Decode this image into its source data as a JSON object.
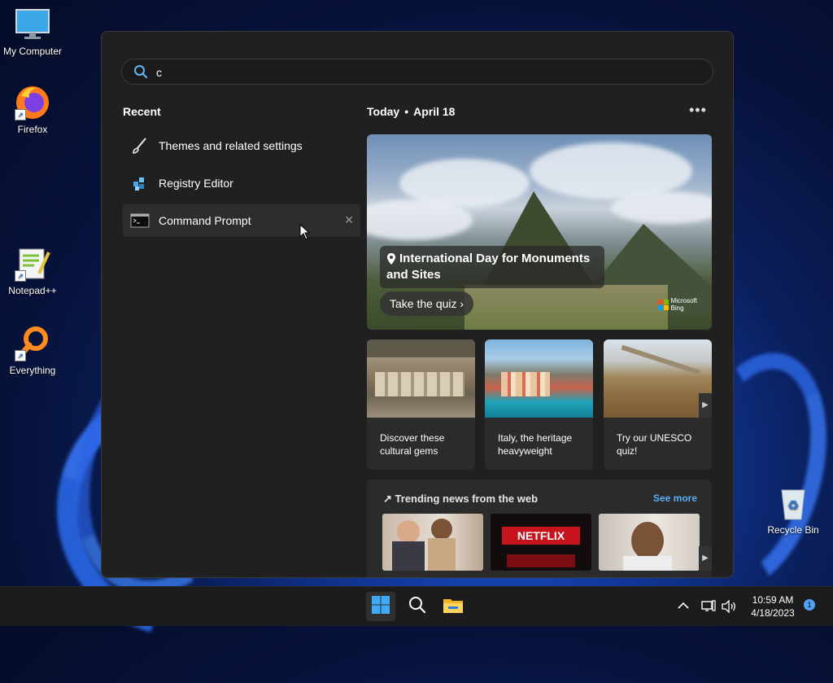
{
  "desktop": {
    "icons": [
      {
        "label": "My Computer"
      },
      {
        "label": "Firefox"
      },
      {
        "label": "Notepad++"
      },
      {
        "label": "Everything"
      },
      {
        "label": "Recycle Bin"
      }
    ]
  },
  "search": {
    "value": "c",
    "placeholder": ""
  },
  "recent": {
    "title": "Recent",
    "items": [
      {
        "label": "Themes and related settings",
        "icon": "brush-icon"
      },
      {
        "label": "Registry Editor",
        "icon": "registry-icon"
      },
      {
        "label": "Command Prompt",
        "icon": "terminal-icon",
        "close": "✕"
      }
    ]
  },
  "widgets": {
    "day": "Today",
    "date": "April 18",
    "more": "•••",
    "hero": {
      "title": "International Day for Monuments and Sites",
      "button": "Take the quiz",
      "brand_line1": "Microsoft",
      "brand_line2": "Bing"
    },
    "cards": [
      {
        "text": "Discover these cultural gems"
      },
      {
        "text": "Italy, the heritage heavyweight"
      },
      {
        "text": "Try our UNESCO quiz!"
      }
    ],
    "trending": {
      "title": "Trending news from the web",
      "see_more": "See more",
      "thumb2_text": "NETFLIX"
    }
  },
  "taskbar": {
    "time": "10:59 AM",
    "date": "4/18/2023",
    "notification_count": "1"
  },
  "colors": {
    "accent": "#4fa3f7",
    "panel": "#202020",
    "link": "#5aaef7"
  }
}
